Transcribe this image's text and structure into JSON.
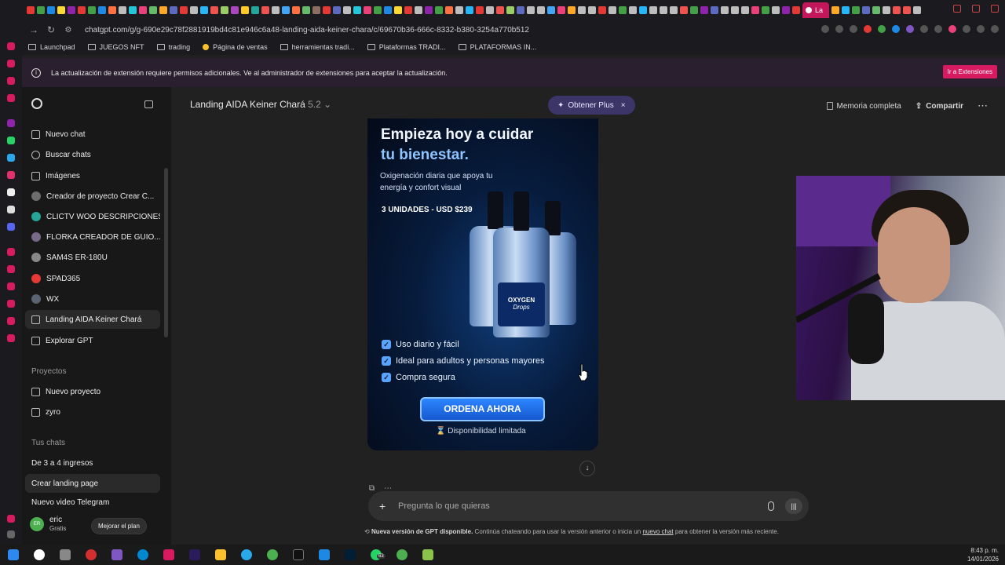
{
  "browser": {
    "url": "chatgpt.com/g/g-690e29c78f2881919bd4c81e946c6a48-landing-aida-keiner-chara/c/69670b36-666c-8332-b380-3254a770b512",
    "active_tab_label": "La",
    "bookmarks": [
      "Launchpad",
      "JUEGOS NFT",
      "trading",
      "Página de ventas",
      "herramientas tradi...",
      "Plataformas TRADI...",
      "PLATAFORMAS IN..."
    ]
  },
  "notification": {
    "text": "La actualización de extensión requiere permisos adicionales. Ve al administrador de extensiones para aceptar la actualización.",
    "button": "Ir a Extensiones"
  },
  "sidebar": {
    "items": [
      {
        "label": "Nuevo chat",
        "icon": "edit-icon"
      },
      {
        "label": "Buscar chats",
        "icon": "search-icon"
      },
      {
        "label": "Imágenes",
        "icon": "image-icon"
      },
      {
        "label": "Creador de proyecto Crear C...",
        "icon": "gpt-avatar"
      },
      {
        "label": "CLICTV WOO DESCRIPCIONES",
        "icon": "gpt-avatar"
      },
      {
        "label": "FLORKA CREADOR DE GUIO...",
        "icon": "gpt-avatar"
      },
      {
        "label": "SAM4S ER-180U",
        "icon": "gpt-avatar"
      },
      {
        "label": "SPAD365",
        "icon": "gpt-avatar"
      },
      {
        "label": "WX",
        "icon": "gpt-avatar"
      },
      {
        "label": "Landing AIDA Keiner Chará",
        "icon": "cube-icon"
      },
      {
        "label": "Explorar GPT",
        "icon": "cube-icon"
      }
    ],
    "projects_heading": "Proyectos",
    "projects": [
      {
        "label": "Nuevo proyecto",
        "icon": "new-folder-icon"
      },
      {
        "label": "zyro",
        "icon": "folder-icon"
      }
    ],
    "chats_heading": "Tus chats",
    "chats": [
      "De 3 a 4 ingresos",
      "Crear landing page",
      "Nuevo video Telegram"
    ],
    "user": {
      "initials": "ER",
      "name": "eric",
      "plan": "Gratis"
    },
    "upgrade_label": "Mejorar el plan"
  },
  "header": {
    "title": "Landing AIDA Keiner Chará",
    "version": "5.2",
    "plus_label": "Obtener Plus",
    "memory_label": "Memoria completa",
    "share_label": "Compartir"
  },
  "ad": {
    "headline1": "Empieza hoy a cuidar",
    "headline2": "tu bienestar.",
    "subtitle": "Oxigenación diaria que apoya tu energía y confort visual",
    "units": "3 UNIDADES - USD $239",
    "product_label": "OXYGEN",
    "product_sub": "Drops",
    "benefits": [
      "Uso diario y fácil",
      "Ideal para adultos y personas mayores",
      "Compra segura"
    ],
    "cta": "ORDENA AHORA",
    "availability": "⌛ Disponibilidad limitada"
  },
  "composer": {
    "placeholder": "Pregunta lo que quieras"
  },
  "footer_notice": {
    "bold": "Nueva versión de GPT disponible.",
    "text": "Continúa chateando para usar la versión anterior o inicia un",
    "link": "nuevo chat",
    "text2": "para obtener la versión más reciente."
  },
  "taskbar": {
    "time": "8:43 p. m.",
    "date": "14/01/2026",
    "whatsapp_badge": "63"
  },
  "colors": {
    "background": "#212121",
    "sidebar": "#181818",
    "plus_pill": "#3b3568",
    "extension_button": "#d81b60",
    "cta_blue": "#1f6fe8"
  }
}
